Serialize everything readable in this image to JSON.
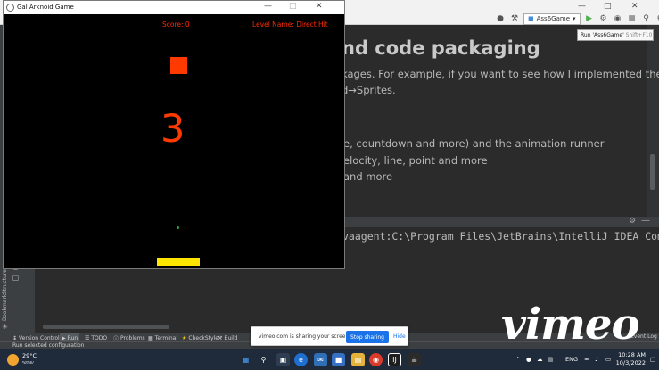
{
  "ide": {
    "run_config": "Ass6Game",
    "tooltip": "Run 'Ass6Game'",
    "tooltip_shortcut": "Shift+F10",
    "heading": "nd code packaging",
    "paragraphs": [
      "kages. For example, if you want to see how I implemented the",
      "d→Sprites.",
      "e, countdown and more) and the animation runner",
      "elocity, line, point and more",
      "and more"
    ],
    "console_line": "vaagent:C:\\Program Files\\JetBrains\\IntelliJ IDEA Com",
    "side_labels": [
      "Structure",
      "Bookmarks"
    ],
    "tool_tabs": [
      "Version Control",
      "Run",
      "TODO",
      "Problems",
      "Terminal",
      "CheckStyle",
      "Build"
    ],
    "event_log": "Event Log",
    "status_text": "Run selected configuration"
  },
  "share_bar": {
    "message": "vimeo.com is sharing your screen.",
    "stop_label": "Stop sharing",
    "hide_label": "Hide"
  },
  "watermark": "vimeo",
  "game": {
    "window_title": "Gal Arknoid Game",
    "score": "Score: 0",
    "level": "Level Name: Direct Hit",
    "countdown": "3",
    "colors": {
      "block": "#ff3a00",
      "paddle": "#ffe600",
      "ball": "#2aa83b",
      "text": "#ff2a00"
    }
  },
  "taskbar": {
    "temperature": "29°C",
    "condition": "שמשי",
    "language": "ENG",
    "time": "10:28 AM",
    "date": "10/3/2022"
  }
}
